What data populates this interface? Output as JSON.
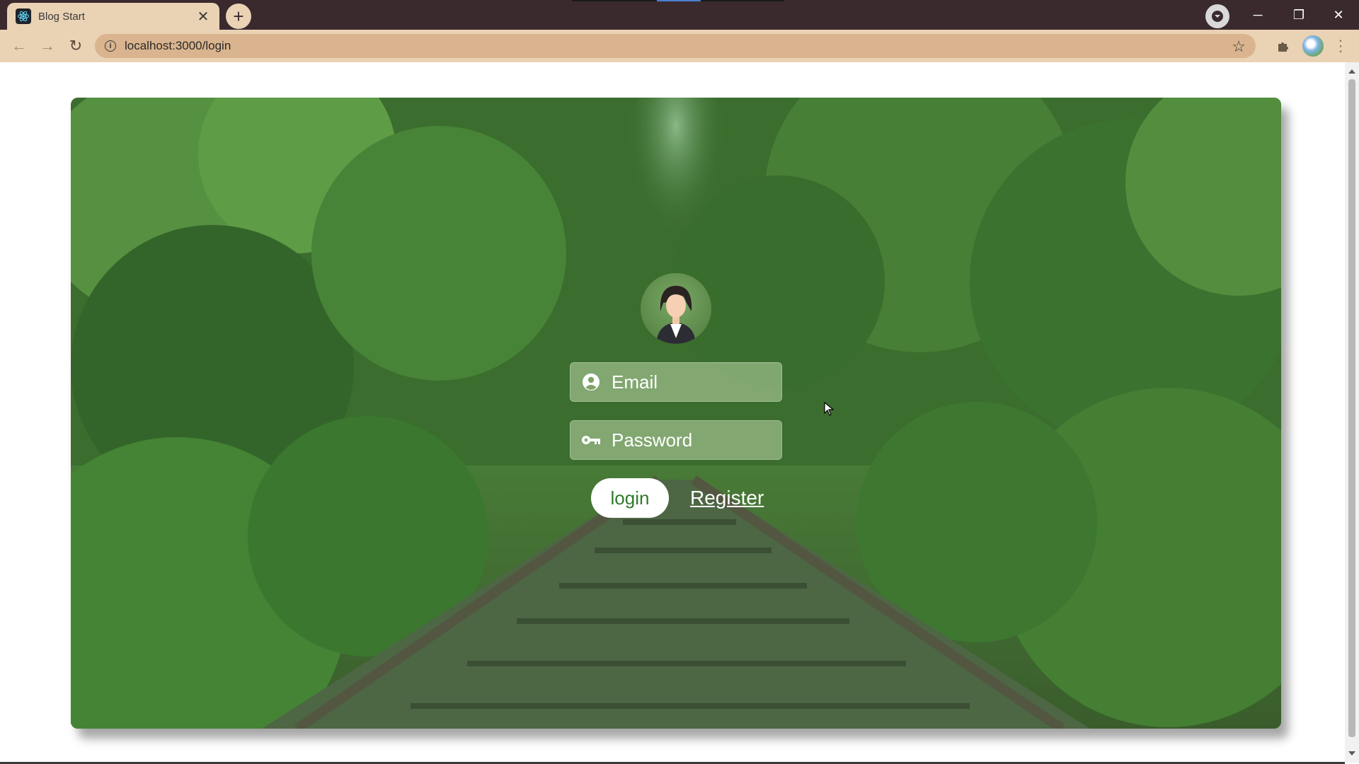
{
  "browser": {
    "tab_title": "Blog Start",
    "tab_close": "✕",
    "new_tab": "+",
    "url": "localhost:3000/login",
    "window_controls": {
      "minimize": "─",
      "restore": "❐",
      "close": "✕"
    },
    "nav_back": "←",
    "nav_forward": "→",
    "nav_reload": "↻",
    "bookmark_star": "☆",
    "menu": "⋮",
    "info": "i"
  },
  "colors": {
    "titlebar": "#3a2a2e",
    "toolbar": "#ead2b4",
    "omnibox": "#d9b48e",
    "accent_green": "#2f7a2a"
  },
  "login": {
    "email_placeholder": "Email",
    "password_placeholder": "Password",
    "login_label": "login",
    "register_label": "Register"
  },
  "icons": {
    "favicon": "react-icon",
    "email": "user-circle-icon",
    "password": "key-icon",
    "avatar": "woman-avatar-icon"
  }
}
